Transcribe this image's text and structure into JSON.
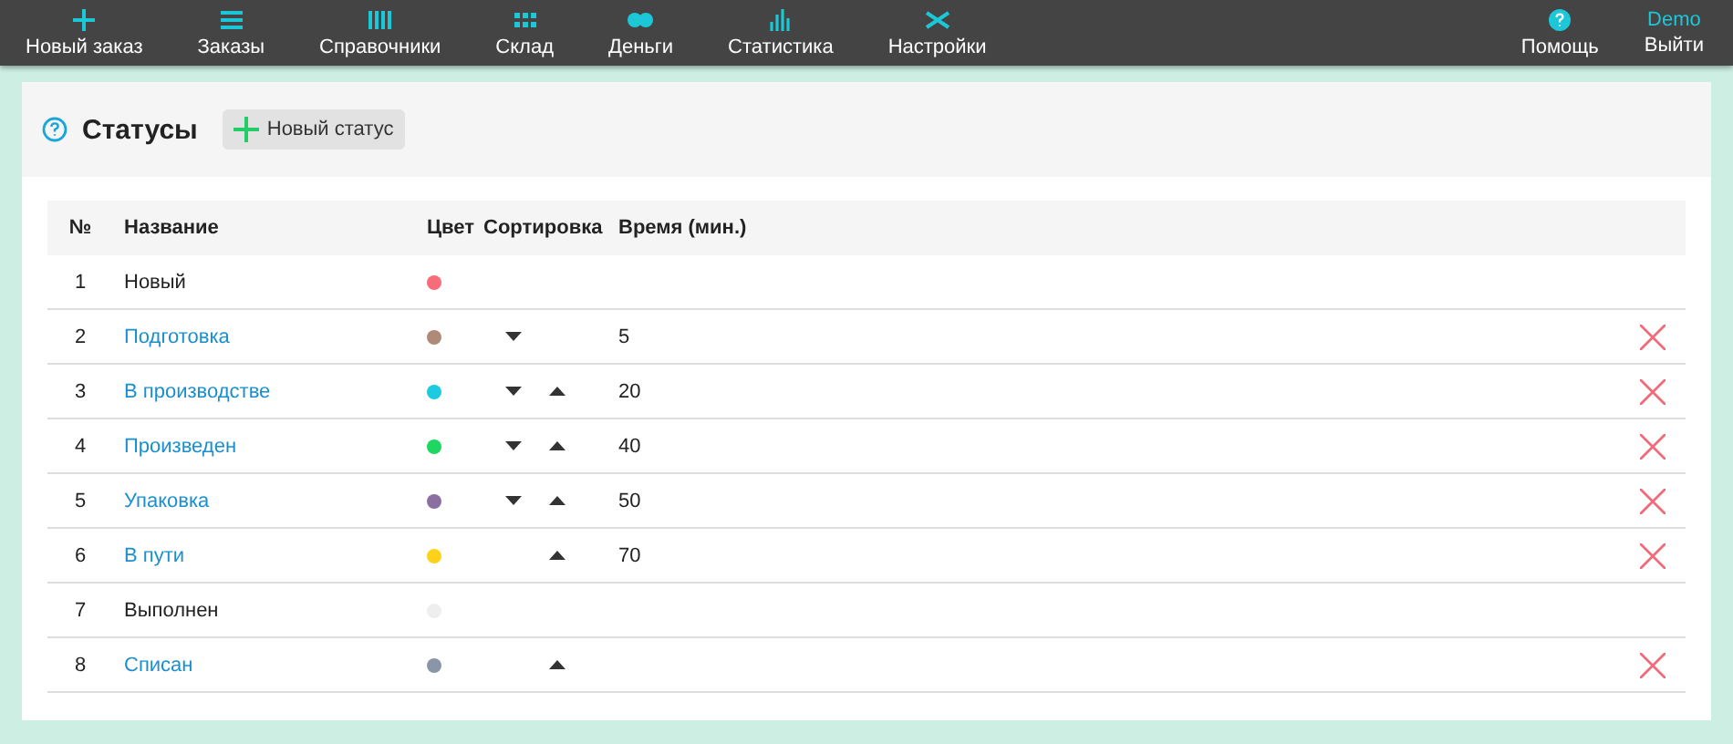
{
  "nav": [
    {
      "label": "Новый заказ"
    },
    {
      "label": "Заказы"
    },
    {
      "label": "Справочники"
    },
    {
      "label": "Склад"
    },
    {
      "label": "Деньги"
    },
    {
      "label": "Статистика"
    },
    {
      "label": "Настройки"
    }
  ],
  "help": {
    "label": "Помощь"
  },
  "user": {
    "name": "Demo",
    "logout": "Выйти"
  },
  "page": {
    "title": "Статусы",
    "new_button": "Новый статус"
  },
  "table": {
    "columns": [
      "№",
      "Название",
      "Цвет",
      "Сортировка",
      "Время (мин.)"
    ],
    "rows": [
      {
        "num": "1",
        "name": "Новый",
        "link": false,
        "color": "#f76b7a",
        "down": false,
        "up": false,
        "time": "",
        "deletable": false
      },
      {
        "num": "2",
        "name": "Подготовка",
        "link": true,
        "color": "#b08a78",
        "down": true,
        "up": false,
        "time": "5",
        "deletable": true
      },
      {
        "num": "3",
        "name": "В производстве",
        "link": true,
        "color": "#1ccbe0",
        "down": true,
        "up": true,
        "time": "20",
        "deletable": true
      },
      {
        "num": "4",
        "name": "Произведен",
        "link": true,
        "color": "#1ed760",
        "down": true,
        "up": true,
        "time": "40",
        "deletable": true
      },
      {
        "num": "5",
        "name": "Упаковка",
        "link": true,
        "color": "#8a6fa0",
        "down": true,
        "up": true,
        "time": "50",
        "deletable": true
      },
      {
        "num": "6",
        "name": "В пути",
        "link": true,
        "color": "#ffd21a",
        "down": false,
        "up": true,
        "time": "70",
        "deletable": true
      },
      {
        "num": "7",
        "name": "Выполнен",
        "link": false,
        "color": "#eeeeee",
        "down": false,
        "up": false,
        "time": "",
        "deletable": false
      },
      {
        "num": "8",
        "name": "Списан",
        "link": true,
        "color": "#8896a8",
        "down": false,
        "up": true,
        "time": "",
        "deletable": true
      }
    ]
  }
}
